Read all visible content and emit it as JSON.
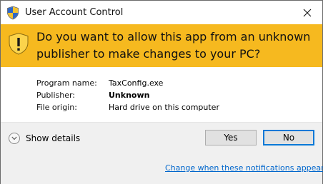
{
  "window": {
    "title": "User Account Control",
    "close_glyph": "✕"
  },
  "banner": {
    "question": "Do you want to allow this app from an unknown publisher to make changes to your PC?",
    "color": "#f6b91f",
    "icon": "warning-shield-icon"
  },
  "details": {
    "rows": [
      {
        "label": "Program name:",
        "value": "TaxConfig.exe"
      },
      {
        "label": "Publisher:",
        "value": "Unknown"
      },
      {
        "label": "File origin:",
        "value": "Hard drive on this computer"
      }
    ]
  },
  "footer": {
    "show_details_label": "Show details",
    "yes_label": "Yes",
    "no_label": "No",
    "notifications_link": "Change when these notifications appear"
  }
}
